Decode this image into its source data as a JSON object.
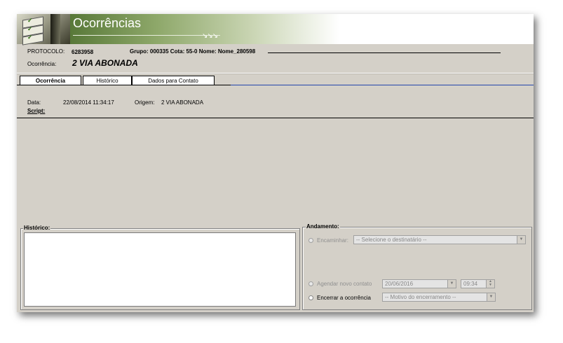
{
  "header": {
    "title": "Ocorrências",
    "arrows": "↘↘↘"
  },
  "info": {
    "protocolo_label": "PROTOCOLO:",
    "protocolo_value": "6283958",
    "grupo_text": "Grupo: 000335 Cota: 55-0 Nome: Nome_280598",
    "ocorrencia_label": "Ocorrência:",
    "ocorrencia_value": "2 VIA ABONADA"
  },
  "tabs": [
    {
      "label": "Ocorrência",
      "active": true
    },
    {
      "label": "Histórico",
      "active": false
    },
    {
      "label": "Dados para Contato",
      "active": false
    }
  ],
  "details": {
    "data_label": "Data:",
    "data_value": "22/08/2014 11:34:17",
    "origem_label": "Origem:",
    "origem_value": "2 VIA ABONADA",
    "script_label": "Script:"
  },
  "historico": {
    "label": "Histórico:"
  },
  "andamento": {
    "label": "Andamento:",
    "encaminhar_label": "Encaminhar:",
    "destinatario_placeholder": "-- Selecione o destinatário --",
    "agendar_label": "Agendar novo contato",
    "agendar_date": "20/06/2016",
    "agendar_time": "09:34",
    "encerrar_label": "Encerrar a ocorrência",
    "motivo_placeholder": "-- Motivo do encerramento --"
  }
}
